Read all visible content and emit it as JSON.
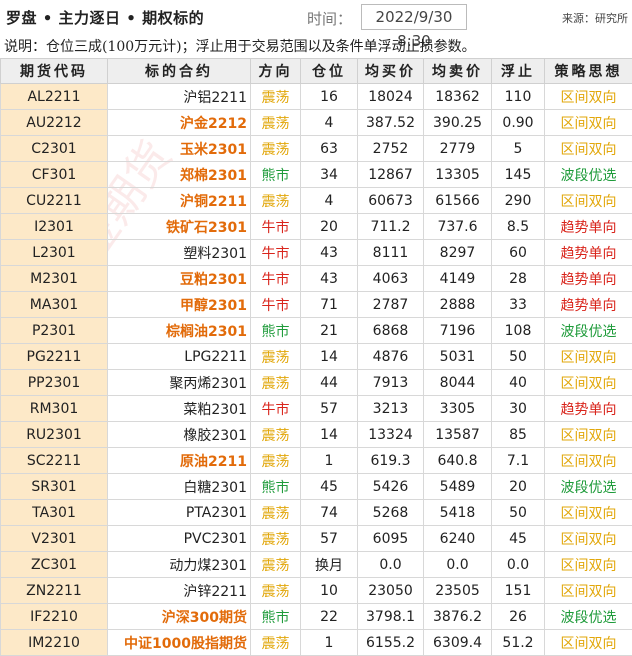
{
  "header": {
    "title": "罗盘 • 主力逐日 • 期权标的",
    "time_label": "时间：",
    "time_value": "2022/9/30 8:30",
    "source": "来源：研究所"
  },
  "note": "说明：仓位三成(100万元计)；浮止用于交易范围以及条件单浮动止损参数。",
  "watermark": "国金期货",
  "columns": [
    "期货代码",
    "标的合约",
    "方向",
    "仓位",
    "均买价",
    "均卖价",
    "浮止",
    "策略思想"
  ],
  "rows": [
    {
      "code": "AL2211",
      "name": "沪铝2211",
      "bold": false,
      "dir": "震荡",
      "pos": "16",
      "buy": "18024",
      "sell": "18362",
      "stop": "110",
      "strategy": "区间双向"
    },
    {
      "code": "AU2212",
      "name": "沪金2212",
      "bold": true,
      "dir": "震荡",
      "pos": "4",
      "buy": "387.52",
      "sell": "390.25",
      "stop": "0.90",
      "strategy": "区间双向"
    },
    {
      "code": "C2301",
      "name": "玉米2301",
      "bold": true,
      "dir": "震荡",
      "pos": "63",
      "buy": "2752",
      "sell": "2779",
      "stop": "5",
      "strategy": "区间双向"
    },
    {
      "code": "CF301",
      "name": "郑棉2301",
      "bold": true,
      "dir": "熊市",
      "pos": "34",
      "buy": "12867",
      "sell": "13305",
      "stop": "145",
      "strategy": "波段优选"
    },
    {
      "code": "CU2211",
      "name": "沪铜2211",
      "bold": true,
      "dir": "震荡",
      "pos": "4",
      "buy": "60673",
      "sell": "61566",
      "stop": "290",
      "strategy": "区间双向"
    },
    {
      "code": "I2301",
      "name": "铁矿石2301",
      "bold": true,
      "dir": "牛市",
      "pos": "20",
      "buy": "711.2",
      "sell": "737.6",
      "stop": "8.5",
      "strategy": "趋势单向"
    },
    {
      "code": "L2301",
      "name": "塑料2301",
      "bold": false,
      "dir": "牛市",
      "pos": "43",
      "buy": "8111",
      "sell": "8297",
      "stop": "60",
      "strategy": "趋势单向"
    },
    {
      "code": "M2301",
      "name": "豆粕2301",
      "bold": true,
      "dir": "牛市",
      "pos": "43",
      "buy": "4063",
      "sell": "4149",
      "stop": "28",
      "strategy": "趋势单向"
    },
    {
      "code": "MA301",
      "name": "甲醇2301",
      "bold": true,
      "dir": "牛市",
      "pos": "71",
      "buy": "2787",
      "sell": "2888",
      "stop": "33",
      "strategy": "趋势单向"
    },
    {
      "code": "P2301",
      "name": "棕榈油2301",
      "bold": true,
      "dir": "熊市",
      "pos": "21",
      "buy": "6868",
      "sell": "7196",
      "stop": "108",
      "strategy": "波段优选"
    },
    {
      "code": "PG2211",
      "name": "LPG2211",
      "bold": false,
      "dir": "震荡",
      "pos": "14",
      "buy": "4876",
      "sell": "5031",
      "stop": "50",
      "strategy": "区间双向"
    },
    {
      "code": "PP2301",
      "name": "聚丙烯2301",
      "bold": false,
      "dir": "震荡",
      "pos": "44",
      "buy": "7913",
      "sell": "8044",
      "stop": "40",
      "strategy": "区间双向"
    },
    {
      "code": "RM301",
      "name": "菜粕2301",
      "bold": false,
      "dir": "牛市",
      "pos": "57",
      "buy": "3213",
      "sell": "3305",
      "stop": "30",
      "strategy": "趋势单向"
    },
    {
      "code": "RU2301",
      "name": "橡胶2301",
      "bold": false,
      "dir": "震荡",
      "pos": "14",
      "buy": "13324",
      "sell": "13587",
      "stop": "85",
      "strategy": "区间双向"
    },
    {
      "code": "SC2211",
      "name": "原油2211",
      "bold": true,
      "dir": "震荡",
      "pos": "1",
      "buy": "619.3",
      "sell": "640.8",
      "stop": "7.1",
      "strategy": "区间双向"
    },
    {
      "code": "SR301",
      "name": "白糖2301",
      "bold": false,
      "dir": "熊市",
      "pos": "45",
      "buy": "5426",
      "sell": "5489",
      "stop": "20",
      "strategy": "波段优选"
    },
    {
      "code": "TA301",
      "name": "PTA2301",
      "bold": false,
      "dir": "震荡",
      "pos": "74",
      "buy": "5268",
      "sell": "5418",
      "stop": "50",
      "strategy": "区间双向"
    },
    {
      "code": "V2301",
      "name": "PVC2301",
      "bold": false,
      "dir": "震荡",
      "pos": "57",
      "buy": "6095",
      "sell": "6240",
      "stop": "45",
      "strategy": "区间双向"
    },
    {
      "code": "ZC301",
      "name": "动力煤2301",
      "bold": false,
      "dir": "震荡",
      "pos": "换月",
      "buy": "0.0",
      "sell": "0.0",
      "stop": "0.0",
      "strategy": "区间双向"
    },
    {
      "code": "ZN2211",
      "name": "沪锌2211",
      "bold": false,
      "dir": "震荡",
      "pos": "10",
      "buy": "23050",
      "sell": "23505",
      "stop": "151",
      "strategy": "区间双向"
    },
    {
      "code": "IF2210",
      "name": "沪深300期货",
      "bold": true,
      "dir": "熊市",
      "pos": "22",
      "buy": "3798.1",
      "sell": "3876.2",
      "stop": "26",
      "strategy": "波段优选"
    },
    {
      "code": "IM2210",
      "name": "中证1000股指期货",
      "bold": true,
      "dir": "震荡",
      "pos": "1",
      "buy": "6155.2",
      "sell": "6309.4",
      "stop": "51.2",
      "strategy": "区间双向"
    }
  ],
  "colors": {
    "震荡": "#e2a70a",
    "熊市": "#1e9b3a",
    "牛市": "#d9251c",
    "区间双向": "#e2a70a",
    "波段优选": "#1e9b3a",
    "趋势单向": "#d9251c",
    "bold_name": "#e26b0a",
    "code_bg": "#fde9c8"
  }
}
